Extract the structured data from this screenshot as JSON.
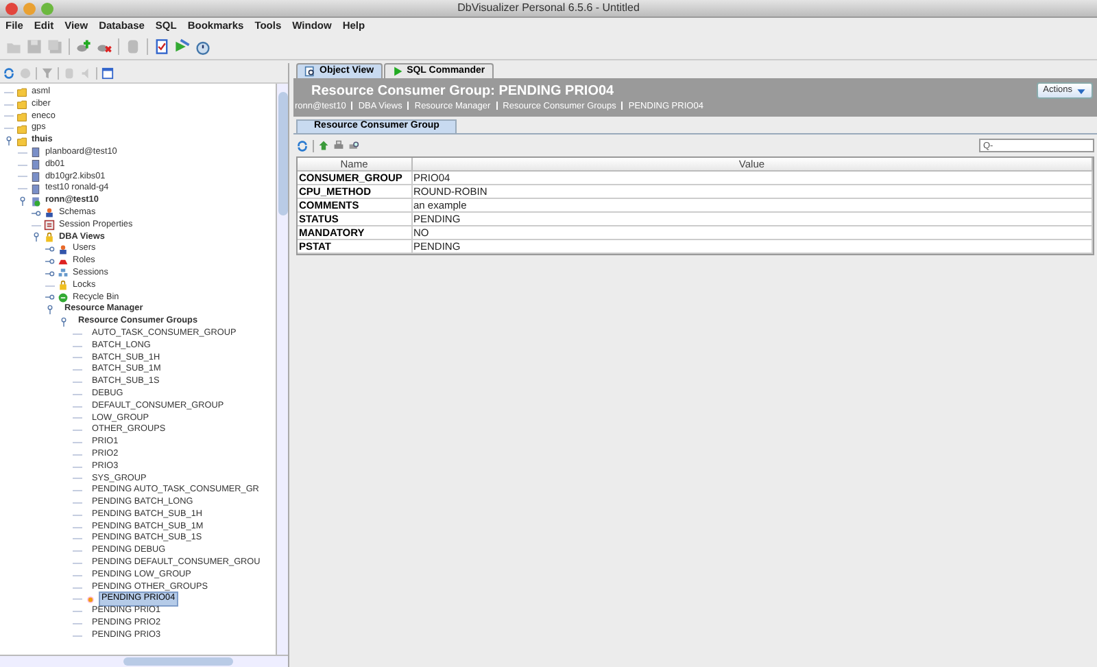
{
  "window": {
    "title": "DbVisualizer Personal 6.5.6 - Untitled"
  },
  "menu": [
    "File",
    "Edit",
    "View",
    "Database",
    "SQL",
    "Bookmarks",
    "Tools",
    "Window",
    "Help"
  ],
  "tree": [
    {
      "label": "asml",
      "kind": "folder",
      "expanded": false,
      "selected": false
    },
    {
      "label": "ciber",
      "kind": "folder",
      "expanded": false,
      "selected": false
    },
    {
      "label": "eneco",
      "kind": "folder",
      "expanded": false,
      "selected": false
    },
    {
      "label": "gps",
      "kind": "folder",
      "expanded": false,
      "selected": false
    },
    {
      "label": "thuis",
      "kind": "folder",
      "expanded": true,
      "selected": false,
      "children": [
        {
          "label": "planboard@test10",
          "kind": "database",
          "expanded": false,
          "selected": false
        },
        {
          "label": "db01",
          "kind": "database",
          "expanded": false,
          "selected": false
        },
        {
          "label": "db10gr2.kibs01",
          "kind": "database",
          "expanded": false,
          "selected": false
        },
        {
          "label": "test10 ronald-g4",
          "kind": "database",
          "expanded": false,
          "selected": false
        },
        {
          "label": "ronn@test10",
          "kind": "connected",
          "expanded": true,
          "selected": false,
          "children": [
            {
              "label": "Schemas",
              "kind": "user",
              "expandable": true,
              "expanded": false,
              "selected": false
            },
            {
              "label": "Session Properties",
              "kind": "properties",
              "expanded": false,
              "selected": false
            },
            {
              "label": "DBA Views",
              "kind": "lock",
              "expanded": true,
              "selected": false,
              "children": [
                {
                  "label": "Users",
                  "kind": "user",
                  "expandable": true,
                  "expanded": false,
                  "selected": false
                },
                {
                  "label": "Roles",
                  "kind": "hat",
                  "expandable": true,
                  "expanded": false,
                  "selected": false
                },
                {
                  "label": "Sessions",
                  "kind": "network",
                  "expandable": true,
                  "expanded": false,
                  "selected": false
                },
                {
                  "label": "Locks",
                  "kind": "lock",
                  "expanded": false,
                  "selected": false
                },
                {
                  "label": "Recycle Bin",
                  "kind": "recycle",
                  "expandable": true,
                  "expanded": false,
                  "selected": false
                },
                {
                  "label": "Resource Manager",
                  "expanded": true,
                  "selected": false,
                  "children": [
                    {
                      "label": "Resource Consumer Groups",
                      "expanded": true,
                      "selected": false,
                      "children": [
                        {
                          "label": "AUTO_TASK_CONSUMER_GROUP",
                          "kind": "none",
                          "expanded": false,
                          "selected": false
                        },
                        {
                          "label": "BATCH_LONG",
                          "kind": "none",
                          "expanded": false,
                          "selected": false
                        },
                        {
                          "label": "BATCH_SUB_1H",
                          "kind": "none",
                          "expanded": false,
                          "selected": false
                        },
                        {
                          "label": "BATCH_SUB_1M",
                          "kind": "none",
                          "expanded": false,
                          "selected": false
                        },
                        {
                          "label": "BATCH_SUB_1S",
                          "kind": "none",
                          "expanded": false,
                          "selected": false
                        },
                        {
                          "label": "DEBUG",
                          "kind": "none",
                          "expanded": false,
                          "selected": false
                        },
                        {
                          "label": "DEFAULT_CONSUMER_GROUP",
                          "kind": "none",
                          "expanded": false,
                          "selected": false
                        },
                        {
                          "label": "LOW_GROUP",
                          "kind": "none",
                          "expanded": false,
                          "selected": false
                        },
                        {
                          "label": "OTHER_GROUPS",
                          "kind": "none",
                          "expanded": false,
                          "selected": false
                        },
                        {
                          "label": "PRIO1",
                          "kind": "none",
                          "expanded": false,
                          "selected": false
                        },
                        {
                          "label": "PRIO2",
                          "kind": "none",
                          "expanded": false,
                          "selected": false
                        },
                        {
                          "label": "PRIO3",
                          "kind": "none",
                          "expanded": false,
                          "selected": false
                        },
                        {
                          "label": "SYS_GROUP",
                          "kind": "none",
                          "expanded": false,
                          "selected": false
                        },
                        {
                          "label": "PENDING AUTO_TASK_CONSUMER_GR",
                          "kind": "none",
                          "expanded": false,
                          "selected": false
                        },
                        {
                          "label": "PENDING BATCH_LONG",
                          "kind": "none",
                          "expanded": false,
                          "selected": false
                        },
                        {
                          "label": "PENDING BATCH_SUB_1H",
                          "kind": "none",
                          "expanded": false,
                          "selected": false
                        },
                        {
                          "label": "PENDING BATCH_SUB_1M",
                          "kind": "none",
                          "expanded": false,
                          "selected": false
                        },
                        {
                          "label": "PENDING BATCH_SUB_1S",
                          "kind": "none",
                          "expanded": false,
                          "selected": false
                        },
                        {
                          "label": "PENDING DEBUG",
                          "kind": "none",
                          "expanded": false,
                          "selected": false
                        },
                        {
                          "label": "PENDING DEFAULT_CONSUMER_GROU",
                          "kind": "none",
                          "expanded": false,
                          "selected": false
                        },
                        {
                          "label": "PENDING LOW_GROUP",
                          "kind": "none",
                          "expanded": false,
                          "selected": false
                        },
                        {
                          "label": "PENDING OTHER_GROUPS",
                          "kind": "none",
                          "expanded": false,
                          "selected": false
                        },
                        {
                          "label": "PENDING PRIO04",
                          "kind": "pending",
                          "expanded": false,
                          "selected": true
                        },
                        {
                          "label": "PENDING PRIO1",
                          "kind": "none",
                          "expanded": false,
                          "selected": false
                        },
                        {
                          "label": "PENDING PRIO2",
                          "kind": "none",
                          "expanded": false,
                          "selected": false
                        },
                        {
                          "label": "PENDING PRIO3",
                          "kind": "none",
                          "expanded": false,
                          "selected": false
                        }
                      ]
                    }
                  ]
                }
              ]
            }
          ]
        }
      ]
    }
  ],
  "tabs": [
    {
      "label": "Object View",
      "kind": "object",
      "selected": true
    },
    {
      "label": "SQL Commander",
      "kind": "play",
      "selected": false
    }
  ],
  "header": {
    "title": "Resource Consumer Group: PENDING PRIO04",
    "breadcrumb": [
      "ronn@test10",
      "DBA Views",
      "Resource Manager",
      "Resource Consumer Groups",
      "PENDING PRIO04"
    ],
    "actions": "Actions"
  },
  "subtabs": [
    {
      "label": "Resource Consumer Group",
      "selected": true
    }
  ],
  "search": {
    "placeholder": "Q-"
  },
  "table": {
    "columns": [
      "Name",
      "Value"
    ],
    "rows": [
      [
        "CONSUMER_GROUP",
        "PRIO04"
      ],
      [
        "CPU_METHOD",
        "ROUND-ROBIN"
      ],
      [
        "COMMENTS",
        "an example"
      ],
      [
        "STATUS",
        "PENDING"
      ],
      [
        "MANDATORY",
        "NO"
      ],
      [
        "PSTAT",
        "PENDING"
      ]
    ]
  }
}
